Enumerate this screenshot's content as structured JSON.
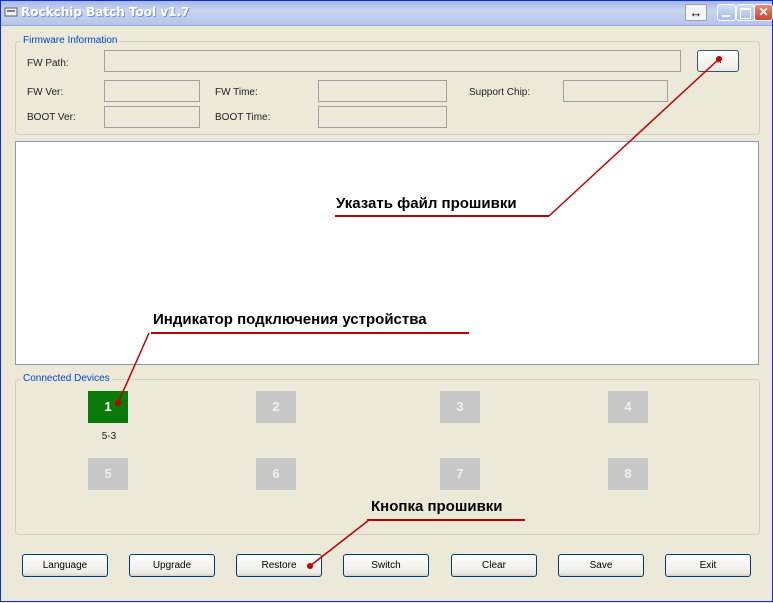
{
  "window": {
    "title": "Rockchip Batch Tool v1.7"
  },
  "titlebar_icons": {
    "resize": "↔",
    "close": "✕"
  },
  "firmware": {
    "group_label": "Firmware Information",
    "fw_path_label": "FW Path:",
    "fw_path_value": "",
    "browse_label": "...",
    "fw_ver_label": "FW Ver:",
    "fw_time_label": "FW Time:",
    "support_chip_label": "Support Chip:",
    "boot_ver_label": "BOOT Ver:",
    "boot_time_label": "BOOT Time:"
  },
  "devices": {
    "group_label": "Connected Devices",
    "items": [
      {
        "label": "1",
        "active": true,
        "sublabel": "5-3"
      },
      {
        "label": "2",
        "active": false
      },
      {
        "label": "3",
        "active": false
      },
      {
        "label": "4",
        "active": false
      },
      {
        "label": "5",
        "active": false
      },
      {
        "label": "6",
        "active": false
      },
      {
        "label": "7",
        "active": false
      },
      {
        "label": "8",
        "active": false
      }
    ]
  },
  "buttons": [
    "Language",
    "Upgrade",
    "Restore",
    "Switch",
    "Clear",
    "Save",
    "Exit"
  ],
  "annotations": {
    "select_firmware": "Указать файл прошивки",
    "device_indicator": "Индикатор подключения устройства",
    "flash_button": "Кнопка прошивки"
  },
  "colors": {
    "active_device": "#0a7a0a",
    "inactive_device": "#c7c7c7",
    "annotation_line": "#c00000",
    "group_label": "#0046d5"
  }
}
